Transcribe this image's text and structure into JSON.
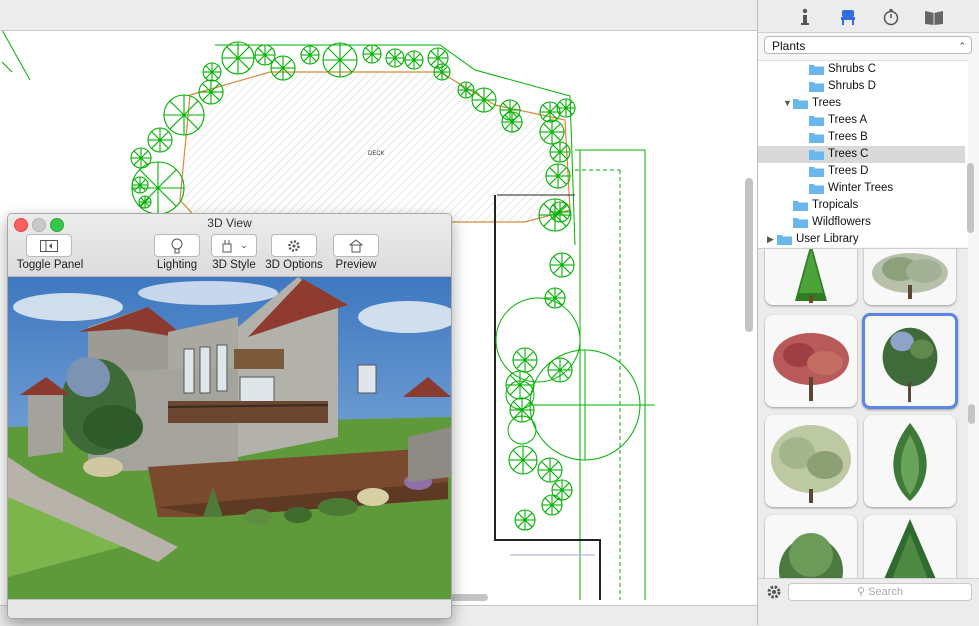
{
  "toolbar": {
    "info_icon": "info-icon",
    "furniture_icon": "chair-icon",
    "timer_icon": "stopwatch-icon",
    "book_icon": "book-icon"
  },
  "plan": {
    "deck_label": "DECK"
  },
  "library": {
    "category": "Plants",
    "tree": [
      {
        "label": "Shrubs C",
        "level": 2
      },
      {
        "label": "Shrubs D",
        "level": 2
      },
      {
        "label": "Trees",
        "level": 1,
        "expanded": true
      },
      {
        "label": "Trees A",
        "level": 2
      },
      {
        "label": "Trees B",
        "level": 2
      },
      {
        "label": "Trees C",
        "level": 2,
        "selected": true
      },
      {
        "label": "Trees D",
        "level": 2
      },
      {
        "label": "Winter Trees",
        "level": 2
      },
      {
        "label": "Tropicals",
        "level": 1
      },
      {
        "label": "Wildflowers",
        "level": 1
      },
      {
        "label": "User Library",
        "level": 0,
        "collapsed": true
      }
    ],
    "search_placeholder": "Search",
    "selected_thumbnail": 4
  },
  "view3d": {
    "title": "3D View",
    "buttons": {
      "toggle": "Toggle Panel",
      "lighting": "Lighting",
      "style": "3D Style",
      "options": "3D Options",
      "preview": "Preview"
    }
  },
  "colors": {
    "plant_green": "#00b000",
    "selection_blue": "#5b86e6",
    "folder_blue": "#6ab7ee"
  }
}
